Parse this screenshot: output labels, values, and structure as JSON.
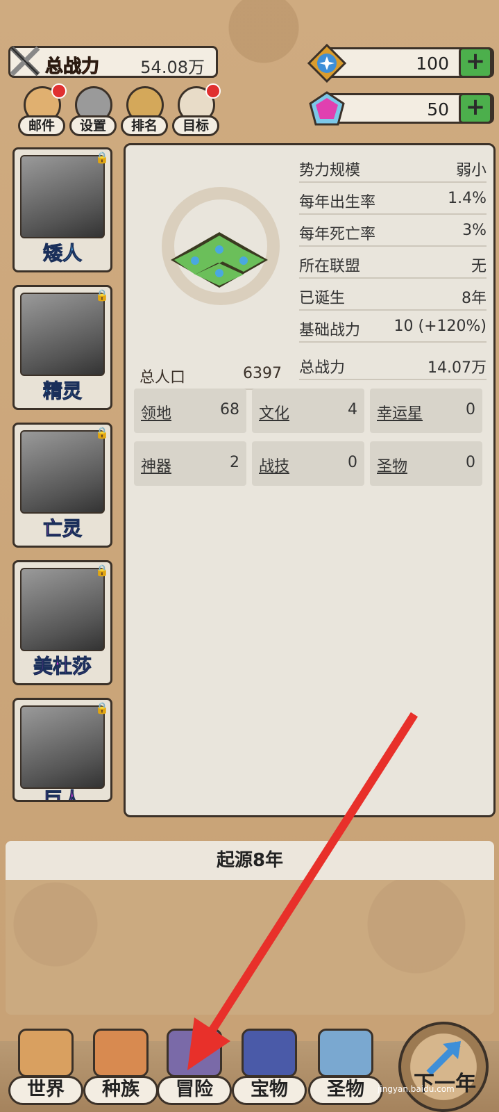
{
  "header": {
    "power_label": "总战力",
    "power_value": "54.08万",
    "resources": [
      {
        "icon": "star-badge-icon",
        "value": "100"
      },
      {
        "icon": "pink-gem-icon",
        "value": "50"
      }
    ],
    "plus_symbol": "+",
    "buttons": [
      {
        "label": "邮件",
        "icon": "mail-icon"
      },
      {
        "label": "设置",
        "icon": "gear-icon"
      },
      {
        "label": "排名",
        "icon": "ranking-icon"
      },
      {
        "label": "目标",
        "icon": "goal-icon"
      }
    ]
  },
  "races": [
    {
      "name": "矮人",
      "color": "#4fb3ee"
    },
    {
      "name": "精灵",
      "color": "#4fb3ee"
    },
    {
      "name": "亡灵",
      "color": "#e83ee8"
    },
    {
      "name": "美杜莎",
      "color": "#e83ee8"
    },
    {
      "name": "巨人",
      "color": "#e83ee8"
    }
  ],
  "faction": {
    "stats": [
      {
        "key": "势力规模",
        "value": "弱小"
      },
      {
        "key": "每年出生率",
        "value": "1.4%"
      },
      {
        "key": "每年死亡率",
        "value": "3%"
      },
      {
        "key": "所在联盟",
        "value": "无"
      },
      {
        "key": "已诞生",
        "value": "8年"
      },
      {
        "key": "基础战力",
        "value": "10 (+120%)"
      },
      {
        "key": "总战力",
        "value": "14.07万"
      }
    ],
    "population_label": "总人口",
    "population_value": "6397",
    "cells": [
      {
        "key": "领地",
        "value": "68"
      },
      {
        "key": "文化",
        "value": "4"
      },
      {
        "key": "幸运星",
        "value": "0"
      },
      {
        "key": "神器",
        "value": "2"
      },
      {
        "key": "战技",
        "value": "0"
      },
      {
        "key": "圣物",
        "value": "0"
      }
    ]
  },
  "era": {
    "title": "起源8年"
  },
  "nav": [
    {
      "label": "世界",
      "icon": "world-map-icon"
    },
    {
      "label": "种族",
      "icon": "race-icon"
    },
    {
      "label": "冒险",
      "icon": "adventure-icon"
    },
    {
      "label": "宝物",
      "icon": "treasure-chest-icon"
    },
    {
      "label": "圣物",
      "icon": "relic-icon"
    }
  ],
  "next_year_label": "下一年",
  "watermark": "jingyan.baidu.com",
  "colors": {
    "accent_red": "#c2402a",
    "plus_green": "#4caf4c",
    "arrow_red": "#e8302a"
  }
}
